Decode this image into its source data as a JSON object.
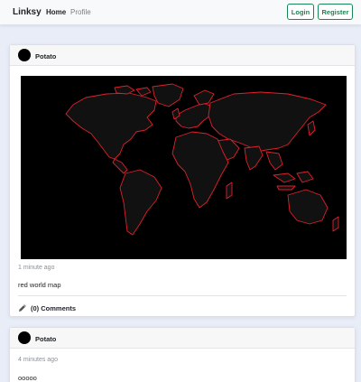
{
  "navbar": {
    "brand": "Linksy",
    "links": [
      {
        "label": "Home",
        "active": true
      },
      {
        "label": "Profile",
        "active": false
      }
    ],
    "login_label": "Login",
    "register_label": "Register",
    "accent_color": "#198754"
  },
  "posts": [
    {
      "author": "Potato",
      "image_icon": "world-map-image",
      "timestamp": "1 minute ago",
      "caption": "red world map",
      "comments_label": "(0) Comments",
      "comments_icon": "pencil-icon"
    },
    {
      "author": "Potato",
      "timestamp": "4 minutes ago",
      "caption": "ooooo"
    }
  ]
}
